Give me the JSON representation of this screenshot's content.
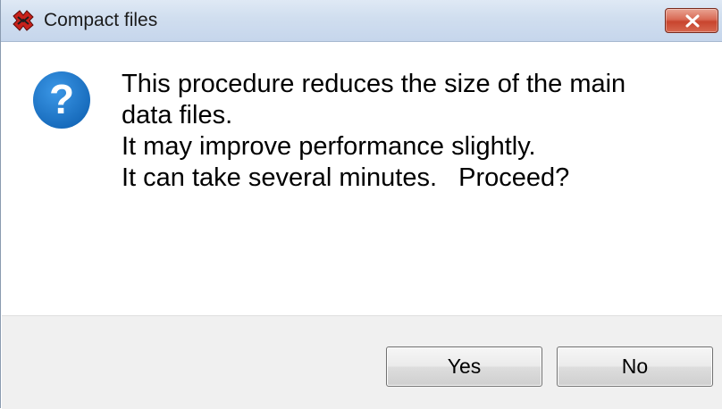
{
  "window": {
    "title": "Compact files",
    "app_icon": "compact-files-app-icon",
    "close_icon": "close-icon"
  },
  "message": {
    "icon": "question-icon",
    "icon_glyph": "?",
    "lines": [
      "This procedure reduces the size of the main",
      "data files.",
      "It may improve performance slightly.",
      "It can take several minutes.   Proceed?"
    ]
  },
  "buttons": {
    "yes_label": "Yes",
    "no_label": "No"
  },
  "colors": {
    "question_icon": "#1a78c9",
    "close_button": "#c8452e",
    "footer_background": "#f0f0f0",
    "titlebar": "#d0deef"
  }
}
